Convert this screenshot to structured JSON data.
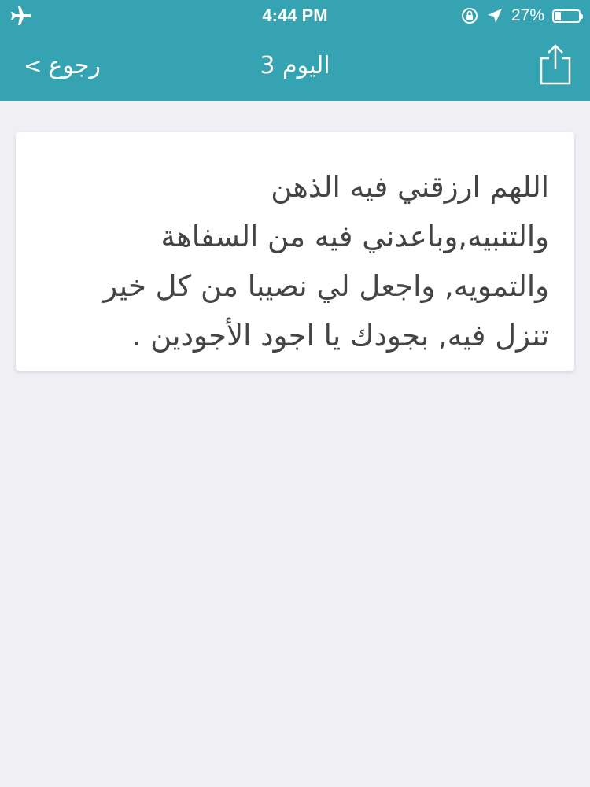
{
  "status_bar": {
    "time": "4:44 PM",
    "battery_percent": "27%",
    "battery_level": 0.27,
    "icons": [
      "airplane-icon",
      "rotation-lock-icon",
      "location-arrow-icon",
      "battery-icon"
    ]
  },
  "nav": {
    "back_label": "رجوع",
    "back_chevron": "<",
    "title": "اليوم 3",
    "share_icon": "share-icon"
  },
  "colors": {
    "header": "#35a3b1",
    "background": "#efeff4",
    "card": "#ffffff",
    "text": "#444444"
  },
  "content": {
    "lines": [
      "اللهم ارزقني فيه الذهن",
      "والتنبيه,وباعدني فيه من السفاهة",
      "والتمويه, واجعل لي نصيبا من كل خير",
      "تنزل فيه, بجودك يا اجود الأجودين ."
    ]
  }
}
